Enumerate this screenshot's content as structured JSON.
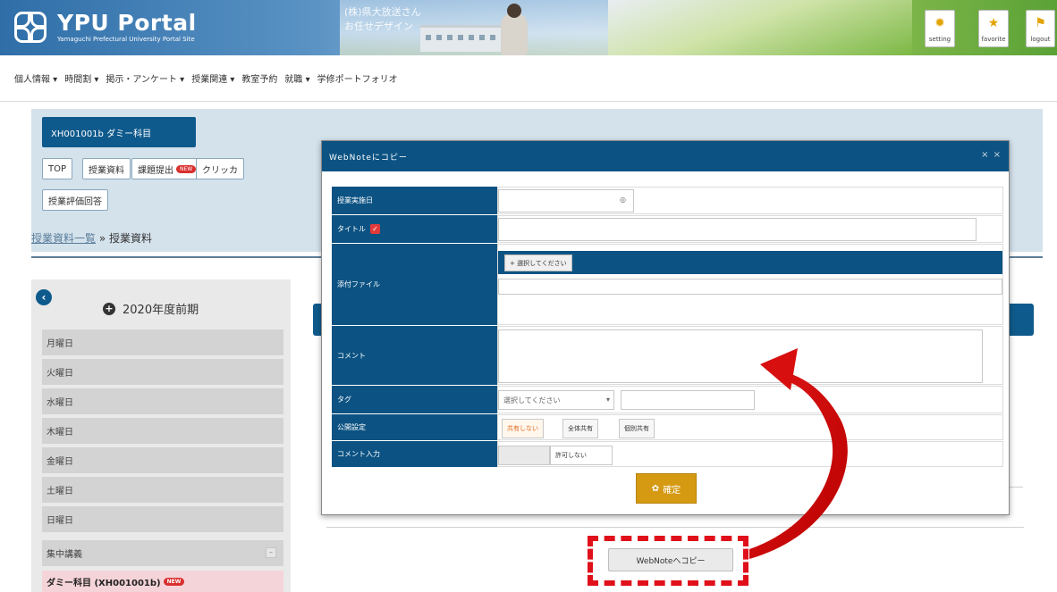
{
  "header": {
    "logo_title": "YPU Portal",
    "logo_sub": "Yamaguchi Prefectural University Portal Site",
    "overlay_line1": "(株)県大放送さん",
    "overlay_line2": "お任せデザイン",
    "buttons": [
      {
        "label": "setting",
        "icon": "gear-icon"
      },
      {
        "label": "favorite",
        "icon": "star-icon"
      },
      {
        "label": "logout",
        "icon": "runner-icon"
      }
    ]
  },
  "nav": {
    "items": [
      "個人情報 ▾",
      "時間割 ▾",
      "掲示・アンケート ▾",
      "授業関連 ▾",
      "教室予約",
      "就職 ▾",
      "学修ポートフォリオ"
    ]
  },
  "course": {
    "code": "XH001001b ダミー科目",
    "tabs": [
      "TOP",
      "授業資料",
      "課題提出",
      "クリッカ"
    ],
    "new_badge": "NEW",
    "eval_tab": "授業評価回答"
  },
  "breadcrumb": {
    "link": "授業資料一覧",
    "separator": "»",
    "current": "授業資料"
  },
  "sidebar": {
    "term": "2020年度前期",
    "days": [
      "月曜日",
      "火曜日",
      "水曜日",
      "木曜日",
      "金曜日",
      "土曜日",
      "日曜日",
      "集中講義"
    ],
    "active_item": "ダミー科目 (XH001001b)",
    "active_badge": "NEW"
  },
  "modal": {
    "title": "WebNoteにコピー",
    "close": "× ×",
    "fields": {
      "date_label": "授業実施日",
      "title_label": "タイトル",
      "attach_label": "添付ファイル",
      "attach_button": "+ 選択してください",
      "comment_label": "コメント",
      "tag_label": "タグ",
      "tag_select": "選択してください",
      "tag_select_arrow": "▾",
      "visibility_label": "公開設定",
      "visibility_options": [
        "共有しない",
        "全体共有",
        "個別共有"
      ],
      "comment_input_label": "コメント入力",
      "comment_input_value": "許可しない",
      "date_icon": "◎"
    },
    "confirm_label": "確定",
    "confirm_icon": "✿"
  },
  "copy_button": "WebNoteへコピー",
  "colors": {
    "primary": "#0c5383",
    "accent": "#d59a12",
    "annotation": "#e0101a",
    "sidebar_active": "#f5d4d9"
  }
}
